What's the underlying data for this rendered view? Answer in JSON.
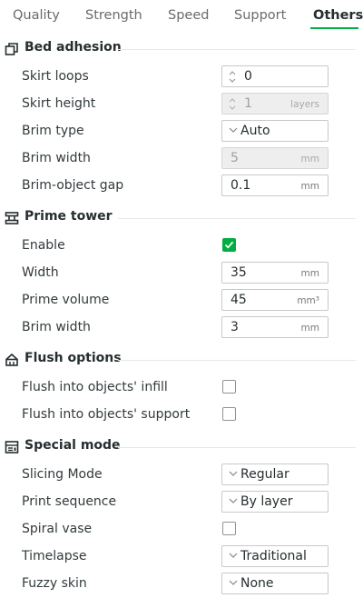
{
  "tabs": [
    {
      "label": "Quality"
    },
    {
      "label": "Strength"
    },
    {
      "label": "Speed"
    },
    {
      "label": "Support"
    },
    {
      "label": "Others",
      "active": true
    }
  ],
  "accent_color": "#00ae42",
  "sections": {
    "bed_adhesion": {
      "title": "Bed adhesion",
      "icon": "bed-adhesion-icon",
      "skirt_loops": {
        "label": "Skirt loops",
        "value": "0"
      },
      "skirt_height": {
        "label": "Skirt height",
        "value": "1",
        "unit": "layers",
        "disabled": true
      },
      "brim_type": {
        "label": "Brim type",
        "value": "Auto"
      },
      "brim_width": {
        "label": "Brim width",
        "value": "5",
        "unit": "mm",
        "disabled": true
      },
      "brim_object_gap": {
        "label": "Brim-object gap",
        "value": "0.1",
        "unit": "mm"
      }
    },
    "prime_tower": {
      "title": "Prime tower",
      "icon": "prime-tower-icon",
      "enable": {
        "label": "Enable",
        "checked": true
      },
      "width": {
        "label": "Width",
        "value": "35",
        "unit": "mm"
      },
      "prime_volume": {
        "label": "Prime volume",
        "value": "45",
        "unit": "mm³"
      },
      "brim_width": {
        "label": "Brim width",
        "value": "3",
        "unit": "mm"
      }
    },
    "flush_options": {
      "title": "Flush options",
      "icon": "flush-options-icon",
      "into_infill": {
        "label": "Flush into objects' infill",
        "checked": false
      },
      "into_support": {
        "label": "Flush into objects' support",
        "checked": false
      }
    },
    "special_mode": {
      "title": "Special mode",
      "icon": "special-mode-icon",
      "slicing_mode": {
        "label": "Slicing Mode",
        "value": "Regular"
      },
      "print_sequence": {
        "label": "Print sequence",
        "value": "By layer"
      },
      "spiral_vase": {
        "label": "Spiral vase",
        "checked": false
      },
      "timelapse": {
        "label": "Timelapse",
        "value": "Traditional"
      },
      "fuzzy_skin": {
        "label": "Fuzzy skin",
        "value": "None"
      }
    }
  }
}
